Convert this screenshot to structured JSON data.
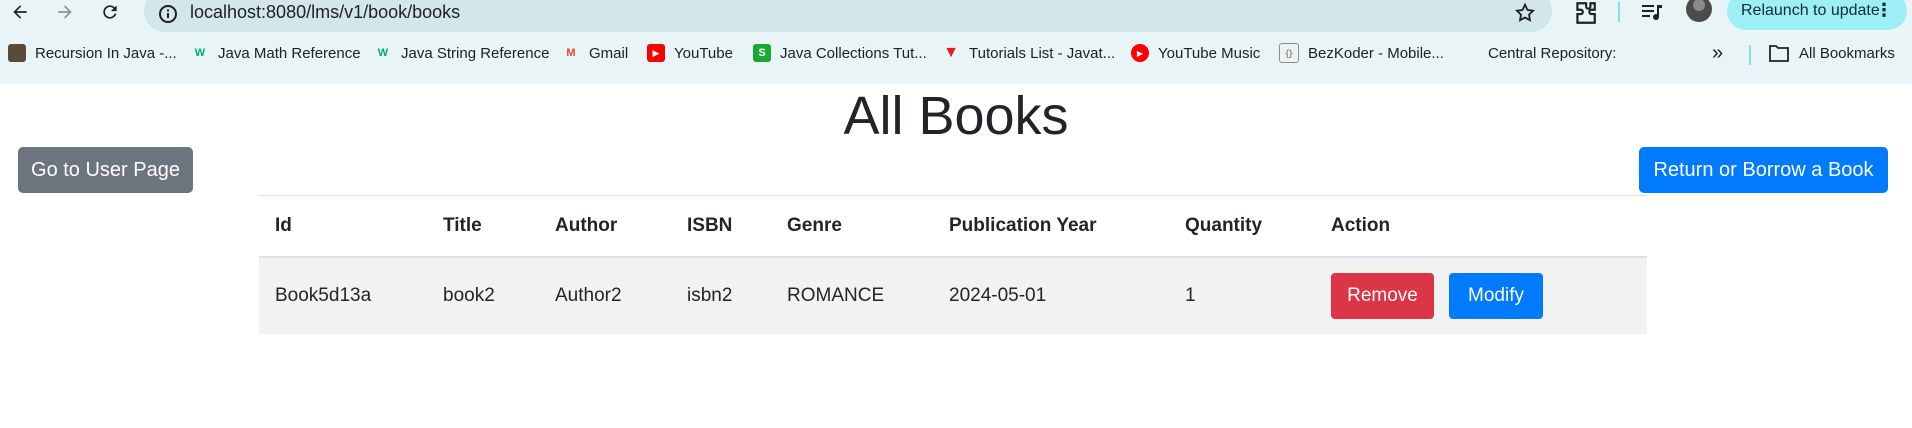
{
  "browser": {
    "url": "localhost:8080/lms/v1/book/books",
    "relaunch_label": "Relaunch to update",
    "bookmarks": [
      {
        "label": "Recursion In Java -...",
        "icon": "book-favicon",
        "color": "#5a4a3a"
      },
      {
        "label": "Java Math Reference",
        "icon": "w3-favicon",
        "color": "#04aa6d"
      },
      {
        "label": "Java String Reference",
        "icon": "w3-favicon",
        "color": "#04aa6d"
      },
      {
        "label": "Gmail",
        "icon": "gmail-favicon",
        "color": "#ea4335"
      },
      {
        "label": "YouTube",
        "icon": "youtube-favicon",
        "color": "#ff0000"
      },
      {
        "label": "Java Collections Tut...",
        "icon": "s-favicon",
        "color": "#1aa835"
      },
      {
        "label": "Tutorials List - Javat...",
        "icon": "javatpoint-favicon",
        "color": "#e51c23"
      },
      {
        "label": "YouTube Music",
        "icon": "youtube-music-favicon",
        "color": "#ff0000"
      },
      {
        "label": "BezKoder - Mobile...",
        "icon": "bezkoder-favicon",
        "color": "#9a8a70"
      },
      {
        "label": "Central Repository:",
        "icon": "",
        "color": ""
      }
    ],
    "more_bookmarks_glyph": "»",
    "all_bookmarks_label": "All Bookmarks"
  },
  "page": {
    "title": "All Books",
    "user_page_button": "Go to User Page",
    "borrow_button": "Return or Borrow a Book"
  },
  "table": {
    "headers": [
      "Id",
      "Title",
      "Author",
      "ISBN",
      "Genre",
      "Publication Year",
      "Quantity",
      "Action"
    ],
    "rows": [
      {
        "id": "Book5d13a",
        "title": "book2",
        "author": "Author2",
        "isbn": "isbn2",
        "genre": "ROMANCE",
        "publication_year": "2024-05-01",
        "quantity": "1",
        "remove_label": "Remove",
        "modify_label": "Modify"
      }
    ]
  },
  "colors": {
    "chrome_bg": "#e8f4f6",
    "secondary_button": "#6c757d",
    "primary_button": "#007bff",
    "danger_button": "#dc3545",
    "row_stripe": "#f2f2f2"
  }
}
